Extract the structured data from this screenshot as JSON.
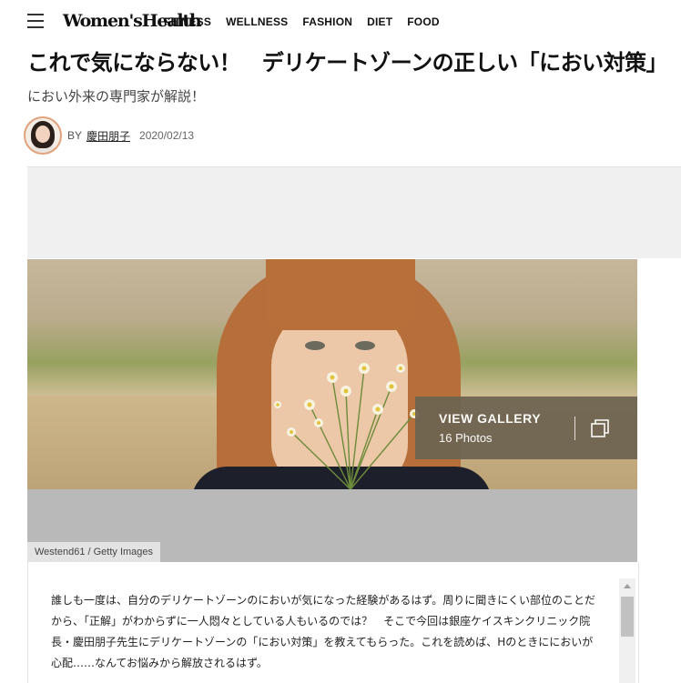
{
  "header": {
    "logo": "Women'sHealth",
    "nav": [
      "FITNESS",
      "WELLNESS",
      "FASHION",
      "DIET",
      "FOOD"
    ]
  },
  "article": {
    "headline": "これで気にならない！　デリケートゾーンの正しい「におい対策」",
    "subhead": "におい外来の専門家が解説！",
    "byline_prefix": "BY",
    "author": "慶田朋子",
    "date": "2020/02/13",
    "body": "誰しも一度は、自分のデリケートゾーンのにおいが気になった経験があるはず。周りに聞きにくい部位のことだから、「正解」がわからずに一人悶々としている人もいるのでは？　そこで今回は銀座ケイスキンクリニック院長・慶田朋子先生にデリケートゾーンの「におい対策」を教えてもらった。これを読めば、Hのときににおいが心配……なんてお悩みから解放されるはず。"
  },
  "gallery": {
    "title": "VIEW GALLERY",
    "count": "16 Photos"
  },
  "image": {
    "credit": "Westend61 / Getty Images"
  },
  "icons": {
    "menu": "hamburger-menu-icon",
    "gallery": "gallery-stack-icon",
    "scroll": "scroll-up-arrow-icon"
  },
  "colors": {
    "avatar_border": "#e0a27b",
    "gallery_bg": "#6f6552"
  }
}
